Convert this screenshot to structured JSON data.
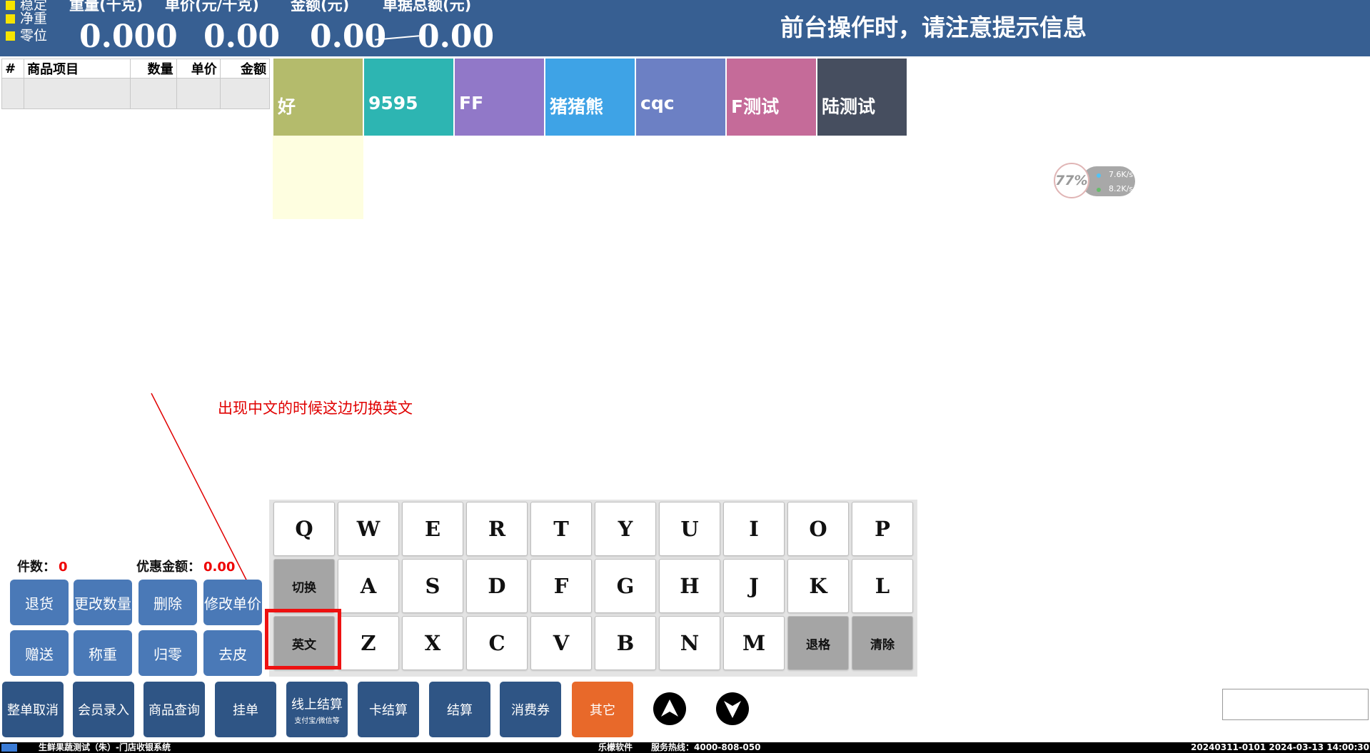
{
  "header": {
    "indicators": [
      "稳定",
      "净重",
      "零位"
    ],
    "readouts": [
      {
        "label": "重量(千克)",
        "value": "0.000"
      },
      {
        "label": "单价(元/千克)",
        "value": "0.00"
      },
      {
        "label": "金额(元)",
        "value": "0.00"
      },
      {
        "label": "单据总额(元)",
        "value": "0.00"
      }
    ],
    "notice": "前台操作时，请注意提示信息",
    "indicator_color": "#f5e400",
    "bar_color": "#375f92"
  },
  "goods_table": {
    "columns": [
      "#",
      "商品项目",
      "数量",
      "单价",
      "金额"
    ]
  },
  "categories": [
    {
      "label": "好",
      "color": "#b4bb6c"
    },
    {
      "label": "9595",
      "color": "#2db5b2"
    },
    {
      "label": "FF",
      "color": "#9178c8"
    },
    {
      "label": "猪猪熊",
      "color": "#3ea3e6"
    },
    {
      "label": "cqc",
      "color": "#6c80c4"
    },
    {
      "label": "F测试",
      "color": "#c56b99"
    },
    {
      "label": "陆测试",
      "color": "#464e5f"
    }
  ],
  "widget": {
    "percent": "77%",
    "up": "7.6K/s",
    "down": "8.2K/s"
  },
  "annotation": {
    "text": "出现中文的时候这边切换英文",
    "color": "#e00000"
  },
  "keyboard": {
    "row1": [
      "Q",
      "W",
      "E",
      "R",
      "T",
      "Y",
      "U",
      "I",
      "O",
      "P"
    ],
    "row2": [
      "切换",
      "A",
      "S",
      "D",
      "F",
      "G",
      "H",
      "J",
      "K",
      "L"
    ],
    "row3": [
      "英文",
      "Z",
      "X",
      "C",
      "V",
      "B",
      "N",
      "M",
      "退格",
      "清除"
    ]
  },
  "summary": {
    "count_label": "件数：",
    "count_value": "0",
    "discount_label": "优惠金额：",
    "discount_value": "0.00"
  },
  "actions": {
    "row1": [
      "退货",
      "更改数量",
      "删除",
      "修改单价"
    ],
    "row2": [
      "赠送",
      "称重",
      "归零",
      "去皮"
    ]
  },
  "bottom_buttons": [
    {
      "label": "整单取消"
    },
    {
      "label": "会员录入"
    },
    {
      "label": "商品查询"
    },
    {
      "label": "挂单"
    },
    {
      "label": "线上结算",
      "sub": "支付宝/微信等"
    },
    {
      "label": "卡结算"
    },
    {
      "label": "结算"
    },
    {
      "label": "消费券"
    },
    {
      "label": "其它",
      "accent": "#e8692a"
    }
  ],
  "nav": {
    "up_icon": "arrow-up-icon",
    "down_icon": "arrow-down-icon"
  },
  "statusbar": {
    "store": "生鲜果蔬测试（朱）-门店收银系统",
    "vendor": "乐檬软件",
    "hotline": "服务热线：4000-808-050",
    "info": "20240311-0101 2024-03-13 14:00:30"
  }
}
